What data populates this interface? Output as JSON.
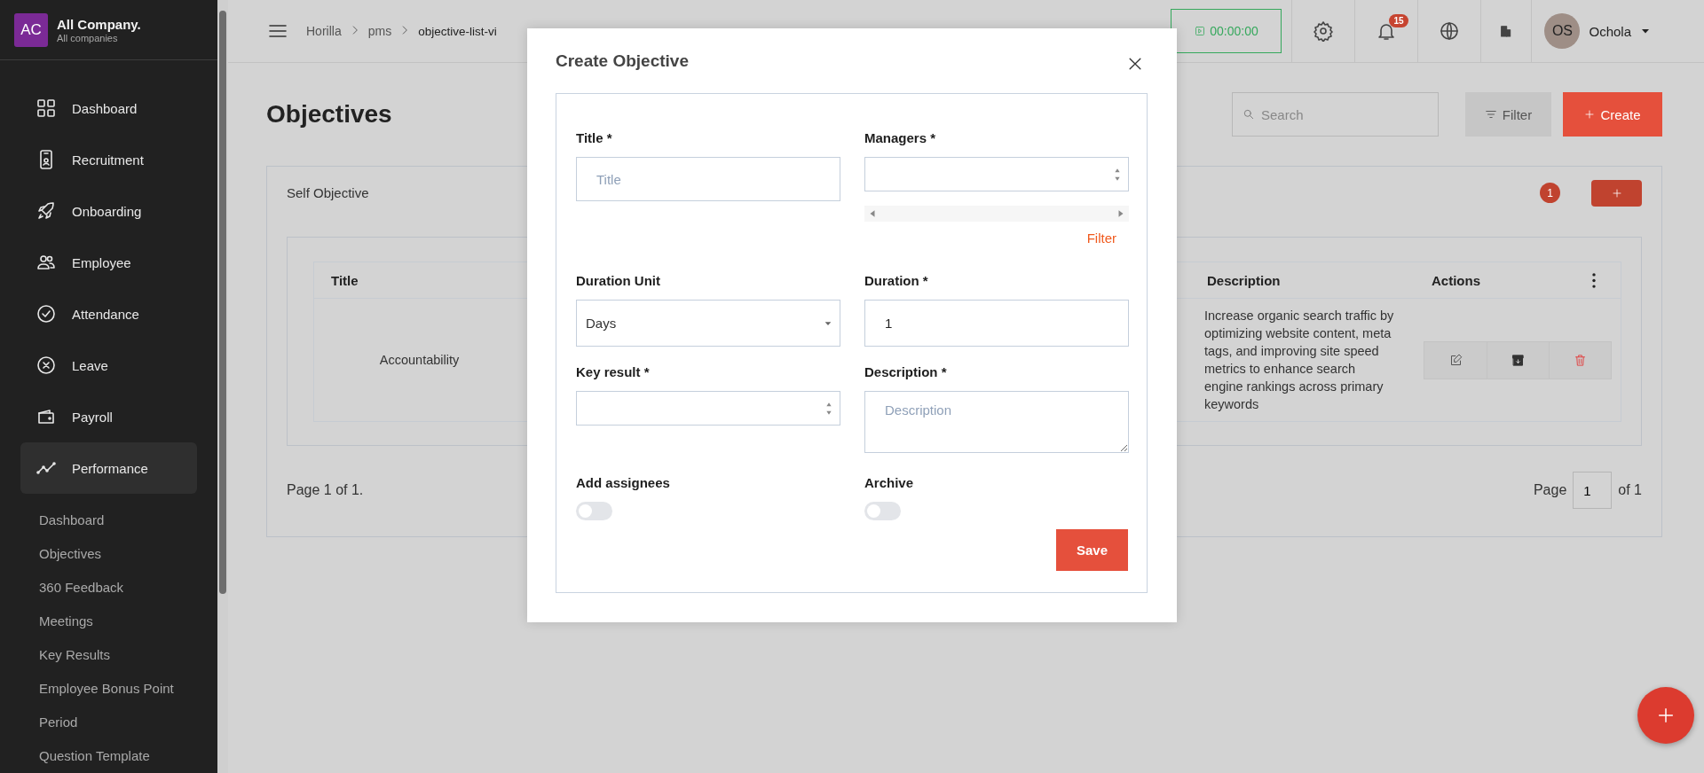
{
  "sidebar": {
    "company": {
      "initials": "AC",
      "name": "All Company.",
      "subtitle": "All companies"
    },
    "items": [
      {
        "label": "Dashboard",
        "selected": false
      },
      {
        "label": "Recruitment",
        "selected": false
      },
      {
        "label": "Onboarding",
        "selected": false
      },
      {
        "label": "Employee",
        "selected": false
      },
      {
        "label": "Attendance",
        "selected": false
      },
      {
        "label": "Leave",
        "selected": false
      },
      {
        "label": "Payroll",
        "selected": false
      },
      {
        "label": "Performance",
        "selected": true
      }
    ],
    "subitems": [
      "Dashboard",
      "Objectives",
      "360 Feedback",
      "Meetings",
      "Key Results",
      "Employee Bonus Point",
      "Period",
      "Question Template"
    ]
  },
  "topbar": {
    "breadcrumb": [
      "Horilla",
      "pms",
      "objective-list-vi"
    ],
    "timer": "00:00:00",
    "notifications": "15",
    "user": {
      "initials": "OS",
      "name": "Ochola"
    }
  },
  "page": {
    "title": "Objectives",
    "search_placeholder": "Search",
    "filter_label": "Filter",
    "create_label": "Create",
    "section": {
      "title": "Self Objective",
      "count": "1"
    },
    "table": {
      "columns": [
        "Title",
        "Description",
        "Actions"
      ],
      "rows": [
        {
          "title": "Accountability",
          "description": "Increase organic search traffic by optimizing website content, meta tags, and improving site speed metrics to enhance search engine rankings across primary keywords"
        }
      ]
    },
    "page_info": "Page 1 of 1.",
    "pager": {
      "label": "Page",
      "value": "1",
      "of": "of 1"
    }
  },
  "modal": {
    "title": "Create Objective",
    "fields": [
      {
        "kind": "text",
        "label": "Title *",
        "placeholder": "Title"
      },
      {
        "kind": "multiselect",
        "label": "Managers *",
        "link": "Filter"
      },
      {
        "kind": "select",
        "label": "Duration Unit",
        "value": "Days"
      },
      {
        "kind": "text",
        "label": "Duration *",
        "value": "1"
      },
      {
        "kind": "number",
        "label": "Key result *"
      },
      {
        "kind": "textarea",
        "label": "Description *",
        "placeholder": "Description"
      },
      {
        "kind": "toggle",
        "label": "Add assignees",
        "on": false
      },
      {
        "kind": "toggle",
        "label": "Archive",
        "on": false
      }
    ],
    "save": "Save"
  }
}
